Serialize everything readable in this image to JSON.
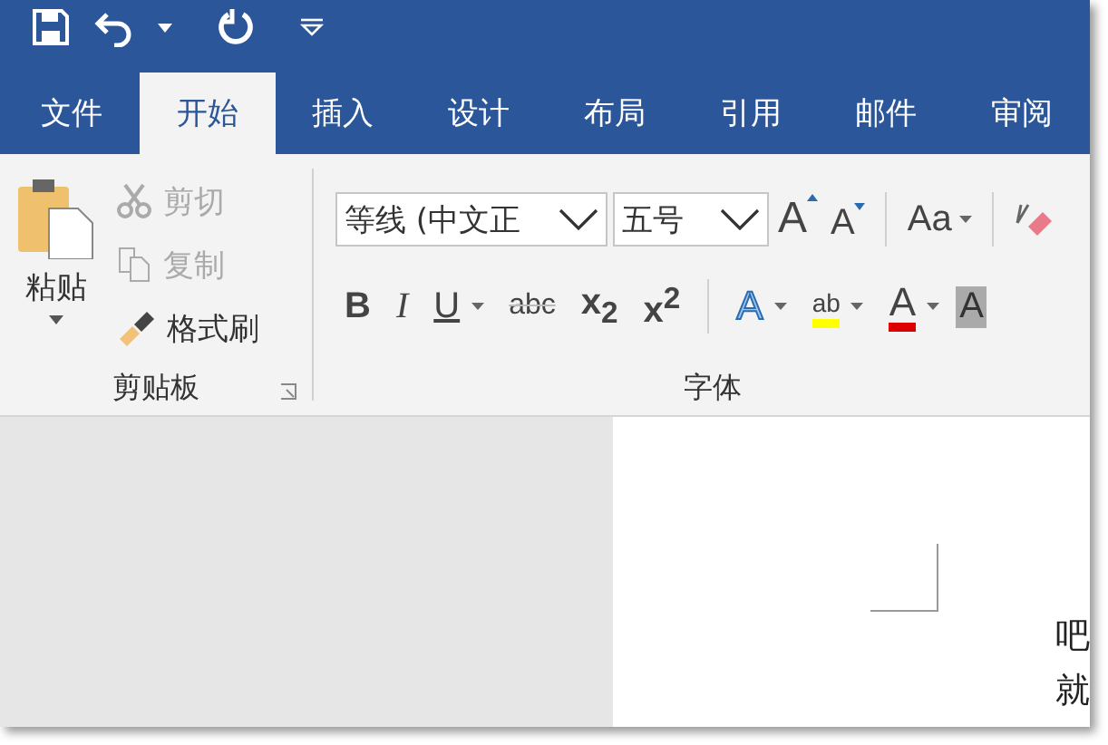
{
  "tabs": [
    {
      "label": "文件",
      "selected": false
    },
    {
      "label": "开始",
      "selected": true
    },
    {
      "label": "插入",
      "selected": false
    },
    {
      "label": "设计",
      "selected": false
    },
    {
      "label": "布局",
      "selected": false
    },
    {
      "label": "引用",
      "selected": false
    },
    {
      "label": "邮件",
      "selected": false
    },
    {
      "label": "审阅",
      "selected": false
    }
  ],
  "clipboard": {
    "paste": "粘贴",
    "items": [
      {
        "kind": "cut",
        "label": "剪切",
        "disabled": true
      },
      {
        "kind": "copy",
        "label": "复制",
        "disabled": true
      },
      {
        "kind": "painter",
        "label": "格式刷",
        "disabled": false
      }
    ],
    "group_label": "剪贴板"
  },
  "font": {
    "font_name": "等线 (中文正",
    "font_size": "五号",
    "grow": "A",
    "shrink": "A",
    "change_case": "Aa",
    "format_buttons": [
      {
        "kind": "bold",
        "label": "B"
      },
      {
        "kind": "italic",
        "label": "I"
      },
      {
        "kind": "underline",
        "label": "U"
      },
      {
        "kind": "strike",
        "label": "abc"
      },
      {
        "kind": "sub",
        "label": "x$_{2}$"
      },
      {
        "kind": "sup",
        "label": "x$^{2}$"
      }
    ],
    "effects": "A",
    "highlight": "ab",
    "font_color": "A",
    "shading": "A",
    "group_label": "字体"
  },
  "document": {
    "lines": [
      "吧",
      "就"
    ]
  }
}
